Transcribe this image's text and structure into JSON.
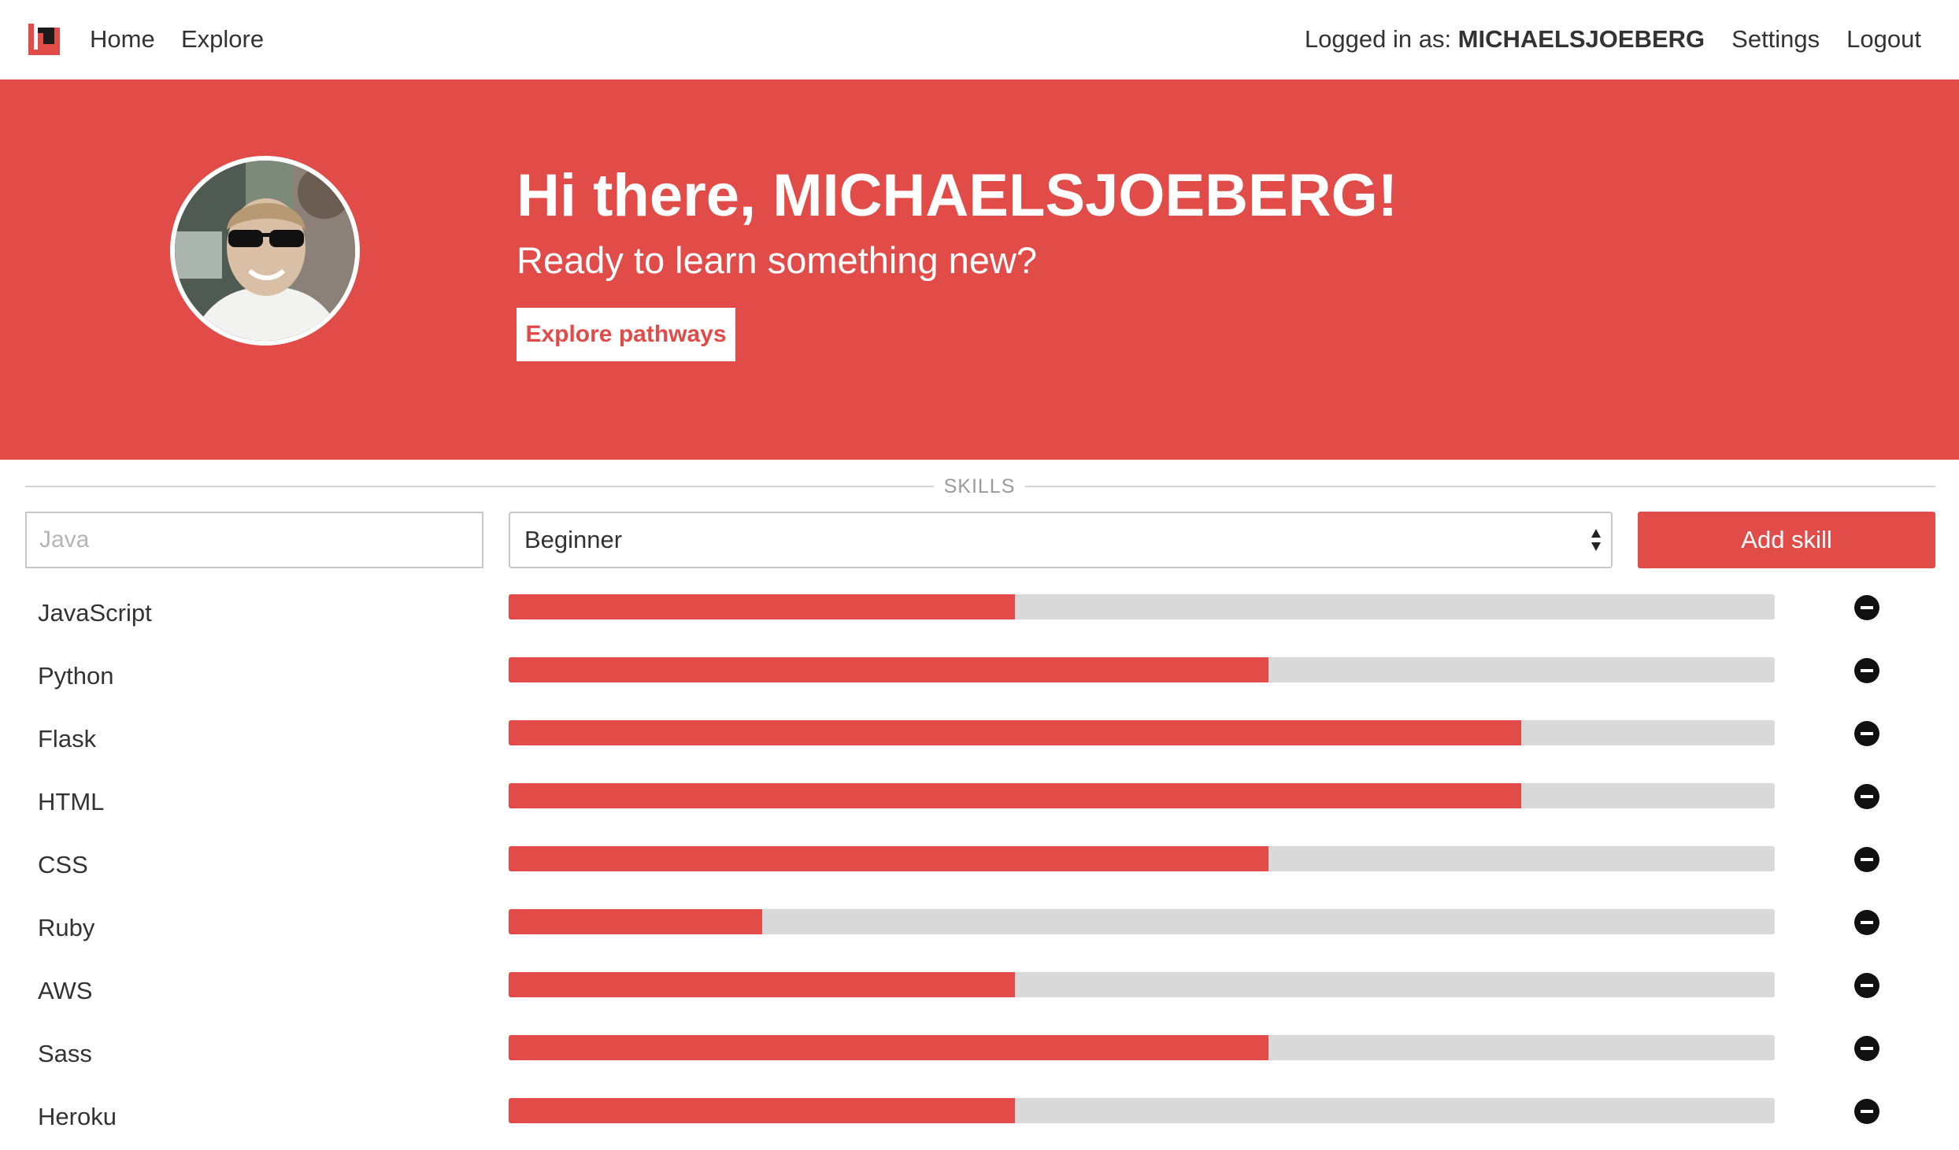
{
  "nav": {
    "home": "Home",
    "explore": "Explore",
    "logged_in_prefix": "Logged in as: ",
    "username": "MICHAELSJOEBERG",
    "settings": "Settings",
    "logout": "Logout"
  },
  "hero": {
    "title": "Hi there, MICHAELSJOEBERG!",
    "subtitle": "Ready to learn something new?",
    "button": "Explore pathways"
  },
  "skills": {
    "section_label": "SKILLS",
    "input_placeholder": "Java",
    "level_selected": "Beginner",
    "add_button": "Add skill",
    "items": [
      {
        "name": "JavaScript",
        "level": 0.4
      },
      {
        "name": "Python",
        "level": 0.6
      },
      {
        "name": "Flask",
        "level": 0.8
      },
      {
        "name": "HTML",
        "level": 0.8
      },
      {
        "name": "CSS",
        "level": 0.6
      },
      {
        "name": "Ruby",
        "level": 0.2
      },
      {
        "name": "AWS",
        "level": 0.4
      },
      {
        "name": "Sass",
        "level": 0.6
      },
      {
        "name": "Heroku",
        "level": 0.4
      }
    ]
  },
  "colors": {
    "accent": "#e14c48",
    "track": "#d9d9d9"
  }
}
